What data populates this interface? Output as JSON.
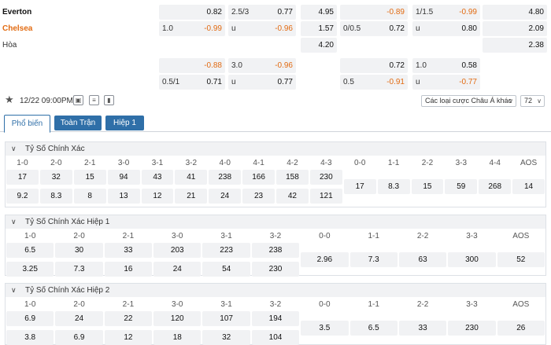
{
  "match": {
    "home": "Everton",
    "away": "Chelsea",
    "draw": "Hòa"
  },
  "odds_rows": [
    [
      {
        "l": "",
        "r": "0.82"
      },
      {
        "l": "2.5/3",
        "r": "0.77"
      },
      {
        "l": "",
        "r": "4.95"
      },
      {
        "l": "",
        "r": "-0.89"
      },
      {
        "l": "1/1.5",
        "r": "-0.99"
      },
      {
        "l": "",
        "r": "4.80"
      }
    ],
    [
      {
        "l": "1.0",
        "r": "-0.99"
      },
      {
        "l": "u",
        "r": "-0.96"
      },
      {
        "l": "",
        "r": "1.57"
      },
      {
        "l": "0/0.5",
        "r": "0.72"
      },
      {
        "l": "u",
        "r": "0.80"
      },
      {
        "l": "",
        "r": "2.09"
      }
    ],
    [
      null,
      null,
      {
        "l": "",
        "r": "4.20"
      },
      null,
      null,
      {
        "l": "",
        "r": "2.38"
      }
    ],
    [
      {
        "l": "",
        "r": "-0.88"
      },
      {
        "l": "3.0",
        "r": "-0.96"
      },
      null,
      {
        "l": "",
        "r": "0.72"
      },
      {
        "l": "1.0",
        "r": "0.58"
      },
      null
    ],
    [
      {
        "l": "0.5/1",
        "r": "0.71"
      },
      {
        "l": "u",
        "r": "0.77"
      },
      null,
      {
        "l": "0.5",
        "r": "-0.91"
      },
      {
        "l": "u",
        "r": "-0.77"
      },
      null
    ]
  ],
  "toolbar": {
    "datetime": "12/22 09:00PM",
    "bet_type": "Các loại cược Châu Á khác",
    "count": "72"
  },
  "tabs": [
    "Phổ biến",
    "Toàn Trận",
    "Hiệp 1"
  ],
  "sections": [
    {
      "title": "Tỷ Số Chính Xác",
      "columns": [
        {
          "h": "1-0",
          "v": [
            "17",
            "9.2"
          ]
        },
        {
          "h": "2-0",
          "v": [
            "32",
            "8.3"
          ]
        },
        {
          "h": "2-1",
          "v": [
            "15",
            "8"
          ]
        },
        {
          "h": "3-0",
          "v": [
            "94",
            "13"
          ]
        },
        {
          "h": "3-1",
          "v": [
            "43",
            "12"
          ]
        },
        {
          "h": "3-2",
          "v": [
            "41",
            "21"
          ]
        },
        {
          "h": "4-0",
          "v": [
            "238",
            "24"
          ]
        },
        {
          "h": "4-1",
          "v": [
            "166",
            "23"
          ]
        },
        {
          "h": "4-2",
          "v": [
            "158",
            "42"
          ]
        },
        {
          "h": "4-3",
          "v": [
            "230",
            "121"
          ]
        },
        {
          "h": "0-0",
          "v": [
            "17"
          ]
        },
        {
          "h": "1-1",
          "v": [
            "8.3"
          ]
        },
        {
          "h": "2-2",
          "v": [
            "15"
          ]
        },
        {
          "h": "3-3",
          "v": [
            "59"
          ]
        },
        {
          "h": "4-4",
          "v": [
            "268"
          ]
        },
        {
          "h": "AOS",
          "v": [
            "14"
          ]
        }
      ]
    },
    {
      "title": "Tỷ Số Chính Xác Hiệp 1",
      "columns": [
        {
          "h": "1-0",
          "v": [
            "6.5",
            "3.25"
          ]
        },
        {
          "h": "2-0",
          "v": [
            "30",
            "7.3"
          ]
        },
        {
          "h": "2-1",
          "v": [
            "33",
            "16"
          ]
        },
        {
          "h": "3-0",
          "v": [
            "203",
            "24"
          ]
        },
        {
          "h": "3-1",
          "v": [
            "223",
            "54"
          ]
        },
        {
          "h": "3-2",
          "v": [
            "238",
            "230"
          ]
        },
        {
          "h": "0-0",
          "v": [
            "2.96"
          ]
        },
        {
          "h": "1-1",
          "v": [
            "7.3"
          ]
        },
        {
          "h": "2-2",
          "v": [
            "63"
          ]
        },
        {
          "h": "3-3",
          "v": [
            "300"
          ]
        },
        {
          "h": "AOS",
          "v": [
            "52"
          ]
        }
      ]
    },
    {
      "title": "Tỷ Số Chính Xác Hiệp 2",
      "columns": [
        {
          "h": "1-0",
          "v": [
            "6.9",
            "3.8"
          ]
        },
        {
          "h": "2-0",
          "v": [
            "24",
            "6.9"
          ]
        },
        {
          "h": "2-1",
          "v": [
            "22",
            "12"
          ]
        },
        {
          "h": "3-0",
          "v": [
            "120",
            "18"
          ]
        },
        {
          "h": "3-1",
          "v": [
            "107",
            "32"
          ]
        },
        {
          "h": "3-2",
          "v": [
            "194",
            "104"
          ]
        },
        {
          "h": "0-0",
          "v": [
            "3.5"
          ]
        },
        {
          "h": "1-1",
          "v": [
            "6.5"
          ]
        },
        {
          "h": "2-2",
          "v": [
            "33"
          ]
        },
        {
          "h": "3-3",
          "v": [
            "230"
          ]
        },
        {
          "h": "AOS",
          "v": [
            "26"
          ]
        }
      ]
    }
  ]
}
